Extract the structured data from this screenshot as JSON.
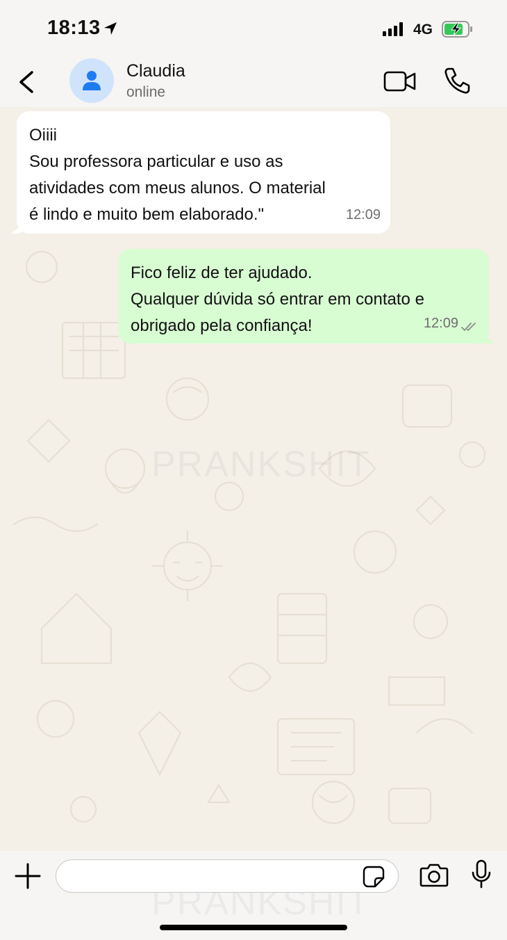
{
  "status_bar": {
    "time": "18:13",
    "network": "4G",
    "icons": [
      "location-arrow-icon",
      "signal-bars-icon",
      "battery-charging-icon"
    ]
  },
  "header": {
    "contact_name": "Claudia",
    "contact_status": "online",
    "icons": [
      "back-chevron-icon",
      "person-icon",
      "video-camera-icon",
      "phone-icon"
    ]
  },
  "watermark": "PRANKSHIT",
  "messages": [
    {
      "direction": "incoming",
      "lines": [
        "Oiiii",
        "Sou professora particular e uso as",
        "atividades com meus alunos. O material",
        "é lindo e muito bem elaborado.\""
      ],
      "time": "12:09"
    },
    {
      "direction": "outgoing",
      "lines": [
        "Fico feliz de ter ajudado.",
        "Qualquer dúvida só entrar em contato e",
        "obrigado pela confiança!"
      ],
      "time": "12:09",
      "status": "read-double-check"
    }
  ],
  "input_bar": {
    "placeholder": "",
    "icons": [
      "plus-icon",
      "sticker-icon",
      "camera-icon",
      "microphone-icon"
    ]
  },
  "colors": {
    "incoming_bubble": "#ffffff",
    "outgoing_bubble": "#d9fdd3",
    "chat_background": "#f4f0e8",
    "avatar_bg": "#cfe3fb",
    "avatar_icon": "#1d7cf2",
    "battery_fill": "#34c759"
  }
}
